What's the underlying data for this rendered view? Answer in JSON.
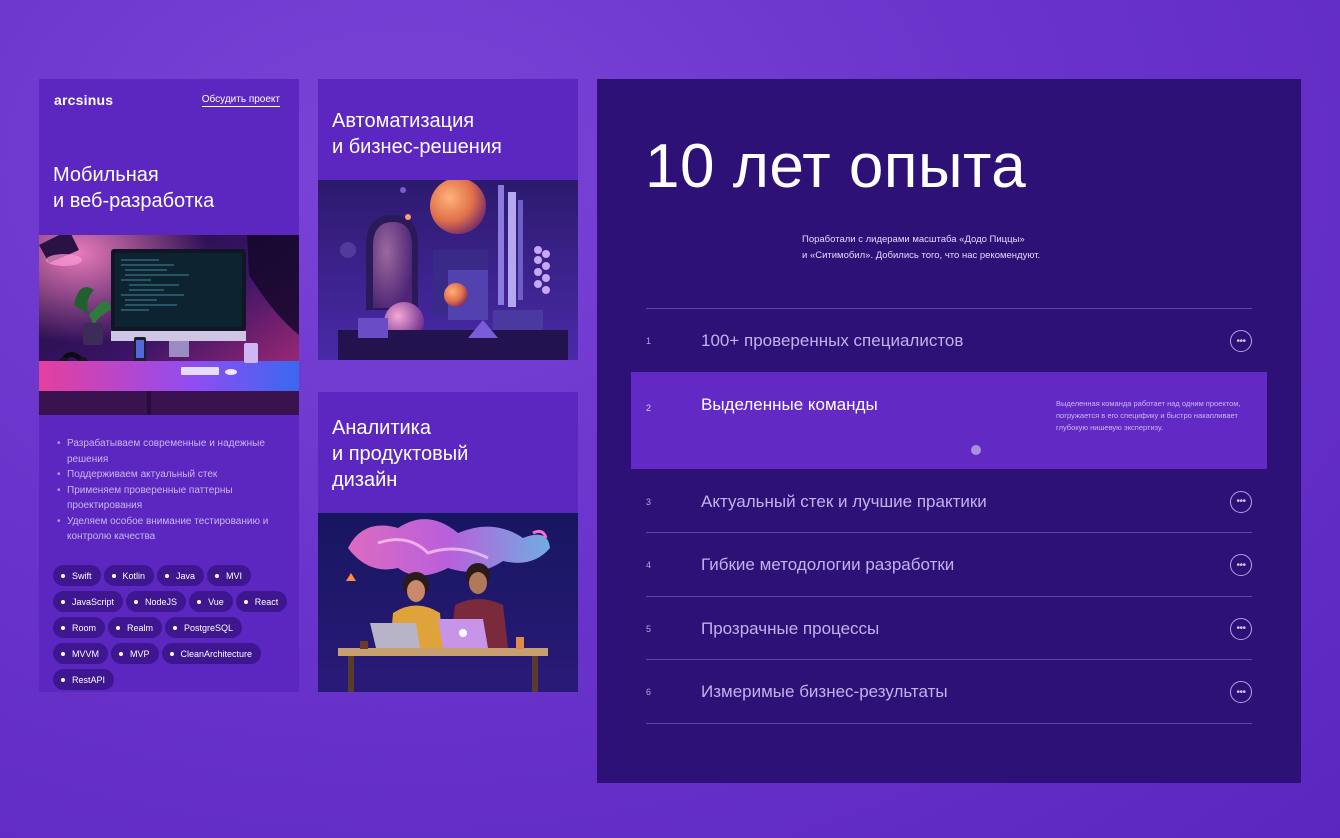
{
  "mobile_card": {
    "logo": "arcsinus",
    "discuss_link": "Обсудить проект",
    "heading": "Мобильная\nи веб-разработка",
    "image_icon": "workstation-illustration",
    "bullets": [
      "Разрабатываем современные и надежные решения",
      "Поддерживаем актуальный стек",
      "Применяем проверенные паттерны проектирования",
      "Уделяем особое внимание тестированию и контролю качества"
    ],
    "tags": [
      "Swift",
      "Kotlin",
      "Java",
      "MVI",
      "JavaScript",
      "NodeJS",
      "Vue",
      "React",
      "Room",
      "Realm",
      "PostgreSQL",
      "MVVM",
      "MVP",
      "CleanArchitecture",
      "RestAPI"
    ]
  },
  "automation_card": {
    "heading": "Автоматизация\nи бизнес-решения",
    "image_icon": "abstract-shapes-illustration"
  },
  "analytics_card": {
    "heading": "Аналитика\nи продуктовый\nдизайн",
    "image_icon": "people-laptops-illustration"
  },
  "experience_panel": {
    "title": "10 лет опыта",
    "subtitle": "Поработали с лидерами масштаба «Додо Пиццы»\nи «Ситимобил». Добились того, что нас рекомендуют.",
    "more_icon": "ellipsis-icon",
    "items": [
      {
        "num": "1",
        "title": "100+ проверенных специалистов"
      },
      {
        "num": "2",
        "title": "Выделенные команды",
        "desc": "Выделенная команда работает над одним проектом, погружается в его специфику и быстро накапливает глубокую нишевую экспертизу."
      },
      {
        "num": "3",
        "title": "Актуальный стек и лучшие практики"
      },
      {
        "num": "4",
        "title": "Гибкие методологии разработки"
      },
      {
        "num": "5",
        "title": "Прозрачные процессы"
      },
      {
        "num": "6",
        "title": "Измеримые бизнес-результаты"
      }
    ]
  },
  "colors": {
    "background": "#6a34cc",
    "card": "#5c27c0",
    "panel": "#2d1177",
    "active_row": "#6329c5",
    "tag": "#3d1690"
  }
}
